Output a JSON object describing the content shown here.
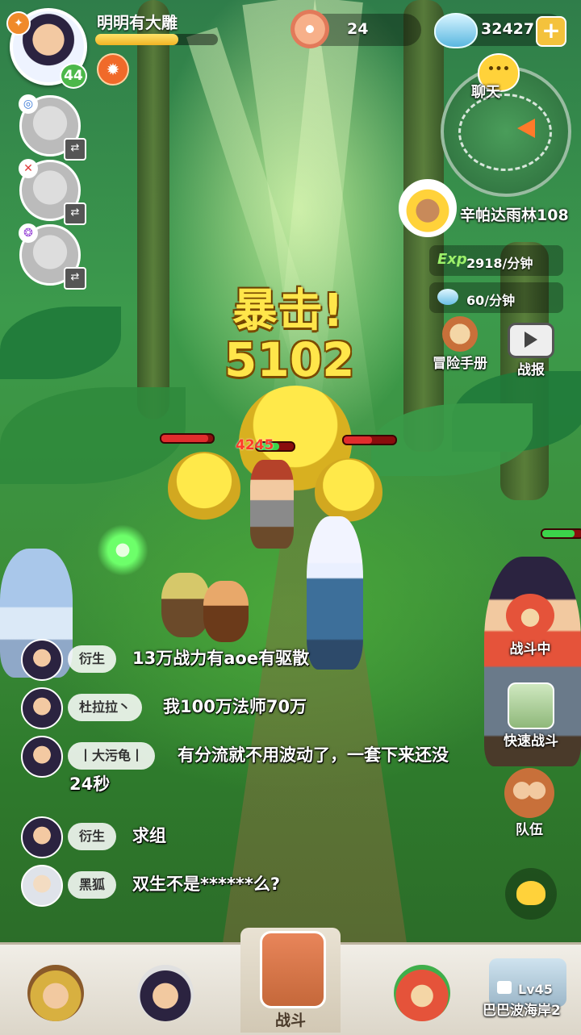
{
  "player": {
    "name": "明明有大雕",
    "level": "44",
    "xp_fraction": 0.68
  },
  "currency": {
    "shells": "24",
    "gems": "32427"
  },
  "chat_button_label": "聊天",
  "zone": {
    "name": "辛帕达雨林108",
    "exp_label": "Exp",
    "exp_rate": "2918/分钟",
    "gem_rate": "60/分钟"
  },
  "side_buttons": {
    "handbook": "冒险手册",
    "battle_report": "战报",
    "in_battle": "战斗中",
    "quick_battle": "快速战斗",
    "team": "队伍"
  },
  "combat": {
    "crit_text": "暴击!",
    "crit_damage": "5102",
    "small_damage": "4245",
    "enemy_hp": [
      0.9,
      0.55,
      0.9
    ]
  },
  "chat": [
    {
      "user": "衍生",
      "message": "13万战力有aoe有驱散"
    },
    {
      "user": "杜拉拉丶",
      "message": "我100万法师70万"
    },
    {
      "user": "丨大污龟丨",
      "message": "有分流就不用波动了，一套下来还没24秒"
    },
    {
      "user": "衍生",
      "message": "求组"
    },
    {
      "user": "黑狐",
      "message": "双生不是******么?"
    }
  ],
  "bottom_nav": {
    "battle_label": "战斗",
    "locked_level": "Lv45",
    "locked_zone": "巴巴波海岸2"
  },
  "colors": {
    "xp_bar": "#f0b425",
    "level_badge": "#4cb84a",
    "damage_text": "#ffe64a",
    "enemy_hp": "#e12d2d"
  }
}
